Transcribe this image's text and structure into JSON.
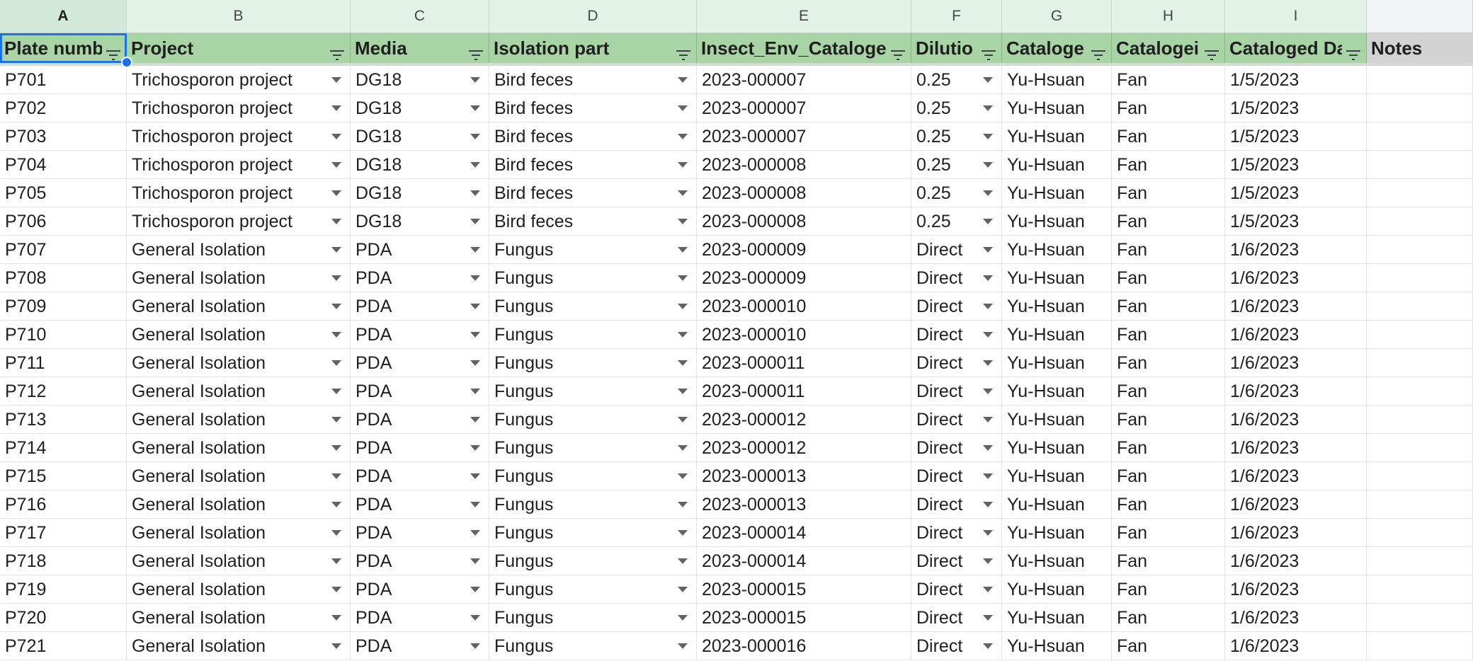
{
  "column_letters": [
    "A",
    "B",
    "C",
    "D",
    "E",
    "F",
    "G",
    "H",
    "I",
    ""
  ],
  "headers": [
    "Plate numb",
    "Project",
    "Media",
    "Isolation part",
    "Insect_Env_Cataloge",
    "Dilutio",
    "Cataloge",
    "Catalogei",
    "Cataloged Da",
    "Notes"
  ],
  "rows": [
    [
      "P701",
      "Trichosporon project",
      "DG18",
      "Bird feces",
      "2023-000007",
      "0.25",
      "Yu-Hsuan",
      "Fan",
      "1/5/2023",
      ""
    ],
    [
      "P702",
      "Trichosporon project",
      "DG18",
      "Bird feces",
      "2023-000007",
      "0.25",
      "Yu-Hsuan",
      "Fan",
      "1/5/2023",
      ""
    ],
    [
      "P703",
      "Trichosporon project",
      "DG18",
      "Bird feces",
      "2023-000007",
      "0.25",
      "Yu-Hsuan",
      "Fan",
      "1/5/2023",
      ""
    ],
    [
      "P704",
      "Trichosporon project",
      "DG18",
      "Bird feces",
      "2023-000008",
      "0.25",
      "Yu-Hsuan",
      "Fan",
      "1/5/2023",
      ""
    ],
    [
      "P705",
      "Trichosporon project",
      "DG18",
      "Bird feces",
      "2023-000008",
      "0.25",
      "Yu-Hsuan",
      "Fan",
      "1/5/2023",
      ""
    ],
    [
      "P706",
      "Trichosporon project",
      "DG18",
      "Bird feces",
      "2023-000008",
      "0.25",
      "Yu-Hsuan",
      "Fan",
      "1/5/2023",
      ""
    ],
    [
      "P707",
      "General Isolation",
      "PDA",
      "Fungus",
      "2023-000009",
      "Direct",
      "Yu-Hsuan",
      "Fan",
      "1/6/2023",
      ""
    ],
    [
      "P708",
      "General Isolation",
      "PDA",
      "Fungus",
      "2023-000009",
      "Direct",
      "Yu-Hsuan",
      "Fan",
      "1/6/2023",
      ""
    ],
    [
      "P709",
      "General Isolation",
      "PDA",
      "Fungus",
      "2023-000010",
      "Direct",
      "Yu-Hsuan",
      "Fan",
      "1/6/2023",
      ""
    ],
    [
      "P710",
      "General Isolation",
      "PDA",
      "Fungus",
      "2023-000010",
      "Direct",
      "Yu-Hsuan",
      "Fan",
      "1/6/2023",
      ""
    ],
    [
      "P711",
      "General Isolation",
      "PDA",
      "Fungus",
      "2023-000011",
      "Direct",
      "Yu-Hsuan",
      "Fan",
      "1/6/2023",
      ""
    ],
    [
      "P712",
      "General Isolation",
      "PDA",
      "Fungus",
      "2023-000011",
      "Direct",
      "Yu-Hsuan",
      "Fan",
      "1/6/2023",
      ""
    ],
    [
      "P713",
      "General Isolation",
      "PDA",
      "Fungus",
      "2023-000012",
      "Direct",
      "Yu-Hsuan",
      "Fan",
      "1/6/2023",
      ""
    ],
    [
      "P714",
      "General Isolation",
      "PDA",
      "Fungus",
      "2023-000012",
      "Direct",
      "Yu-Hsuan",
      "Fan",
      "1/6/2023",
      ""
    ],
    [
      "P715",
      "General Isolation",
      "PDA",
      "Fungus",
      "2023-000013",
      "Direct",
      "Yu-Hsuan",
      "Fan",
      "1/6/2023",
      ""
    ],
    [
      "P716",
      "General Isolation",
      "PDA",
      "Fungus",
      "2023-000013",
      "Direct",
      "Yu-Hsuan",
      "Fan",
      "1/6/2023",
      ""
    ],
    [
      "P717",
      "General Isolation",
      "PDA",
      "Fungus",
      "2023-000014",
      "Direct",
      "Yu-Hsuan",
      "Fan",
      "1/6/2023",
      ""
    ],
    [
      "P718",
      "General Isolation",
      "PDA",
      "Fungus",
      "2023-000014",
      "Direct",
      "Yu-Hsuan",
      "Fan",
      "1/6/2023",
      ""
    ],
    [
      "P719",
      "General Isolation",
      "PDA",
      "Fungus",
      "2023-000015",
      "Direct",
      "Yu-Hsuan",
      "Fan",
      "1/6/2023",
      ""
    ],
    [
      "P720",
      "General Isolation",
      "PDA",
      "Fungus",
      "2023-000015",
      "Direct",
      "Yu-Hsuan",
      "Fan",
      "1/6/2023",
      ""
    ],
    [
      "P721",
      "General Isolation",
      "PDA",
      "Fungus",
      "2023-000016",
      "Direct",
      "Yu-Hsuan",
      "Fan",
      "1/6/2023",
      ""
    ]
  ],
  "selected_column": "A",
  "colors": {
    "header_fill": "#a9d4a5",
    "column_letter_fill": "#e3f2e6",
    "notes_header_fill": "#d2d2d2",
    "selection": "#1a73e8"
  },
  "icons": {
    "filter": "filter-icon",
    "dropdown": "dropdown-arrow-icon"
  }
}
